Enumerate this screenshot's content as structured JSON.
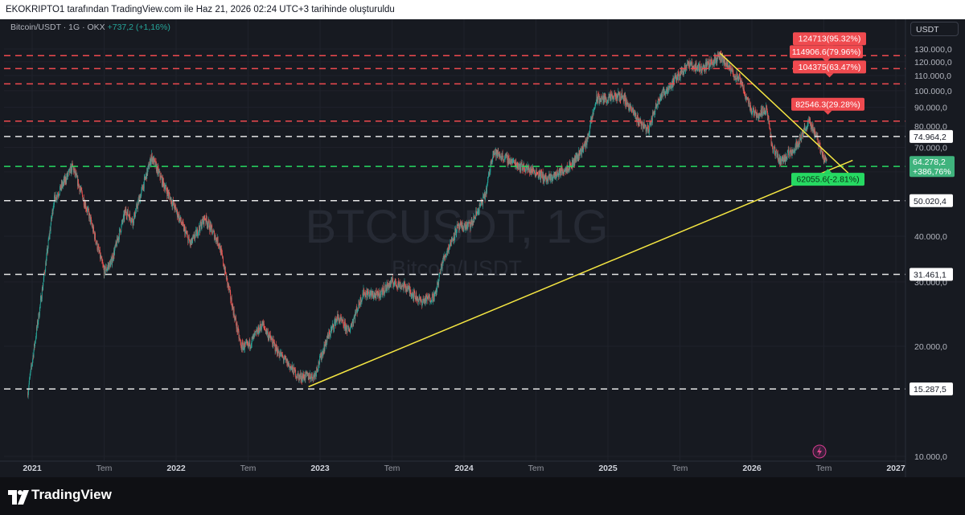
{
  "header": {
    "caption": "EKOKRIPTO1 tarafından TradingView.com ile Haz 21, 2026 02:24 UTC+3 tarihinde oluşturuldu"
  },
  "symbol": {
    "name": "Bitcoin/USDT · 1G · OKX",
    "change": "+737,2 (+1,16%)",
    "currency": "USDT"
  },
  "watermark": {
    "ticker": "BTCUSDT, 1G",
    "description": "Bitcoin/USDT"
  },
  "brand": {
    "name": "TradingView"
  },
  "colors": {
    "background": "#171a21",
    "up": "#26a69a",
    "down": "#ef5350",
    "trendline": "#f5e642",
    "white_level": "#e6e6e6",
    "target_red": "#ef4a4f",
    "target_green": "#26d962",
    "current_price": "#3fb37d"
  },
  "chart_data": {
    "type": "candlestick",
    "instrument": "Bitcoin/USDT",
    "timeframe": "1G",
    "exchange": "OKX",
    "x_range": [
      "2021",
      "2027"
    ],
    "x_ticks": [
      {
        "label": "2021",
        "t": 2021.0
      },
      {
        "label": "Tem",
        "t": 2021.5
      },
      {
        "label": "2022",
        "t": 2022.0
      },
      {
        "label": "Tem",
        "t": 2022.5
      },
      {
        "label": "2023",
        "t": 2023.0
      },
      {
        "label": "Tem",
        "t": 2023.5
      },
      {
        "label": "2024",
        "t": 2024.0
      },
      {
        "label": "Tem",
        "t": 2024.5
      },
      {
        "label": "2025",
        "t": 2025.0
      },
      {
        "label": "Tem",
        "t": 2025.5
      },
      {
        "label": "2026",
        "t": 2026.0
      },
      {
        "label": "Tem",
        "t": 2026.5
      },
      {
        "label": "2027",
        "t": 2027.0
      }
    ],
    "y_scale": "log",
    "y_range": [
      10000,
      130000
    ],
    "y_ticks": [
      {
        "label": "130.000,0",
        "v": 130000
      },
      {
        "label": "120.000,0",
        "v": 120000
      },
      {
        "label": "110.000,0",
        "v": 110000
      },
      {
        "label": "100.000,0",
        "v": 100000
      },
      {
        "label": "90.000,0",
        "v": 90000
      },
      {
        "label": "80.000,0",
        "v": 80000
      },
      {
        "label": "70.000,0",
        "v": 70000
      },
      {
        "label": "60.000,0",
        "v": 60000
      },
      {
        "label": "50.000,0",
        "v": 50000
      },
      {
        "label": "40.000,0",
        "v": 40000
      },
      {
        "label": "30.000,0",
        "v": 30000
      },
      {
        "label": "20.000,0",
        "v": 20000
      },
      {
        "label": "10.000,0",
        "v": 10000
      }
    ],
    "price_path": [
      [
        2020.97,
        15000
      ],
      [
        2021.05,
        25000
      ],
      [
        2021.1,
        35000
      ],
      [
        2021.15,
        50000
      ],
      [
        2021.28,
        62000
      ],
      [
        2021.4,
        45000
      ],
      [
        2021.5,
        32000
      ],
      [
        2021.55,
        34000
      ],
      [
        2021.65,
        47000
      ],
      [
        2021.7,
        44000
      ],
      [
        2021.83,
        66000
      ],
      [
        2021.9,
        57000
      ],
      [
        2022.0,
        47000
      ],
      [
        2022.1,
        38000
      ],
      [
        2022.2,
        45000
      ],
      [
        2022.3,
        38000
      ],
      [
        2022.45,
        20000
      ],
      [
        2022.5,
        20000
      ],
      [
        2022.6,
        23000
      ],
      [
        2022.7,
        19500
      ],
      [
        2022.85,
        16500
      ],
      [
        2022.96,
        16600
      ],
      [
        2023.05,
        21000
      ],
      [
        2023.12,
        24000
      ],
      [
        2023.2,
        22000
      ],
      [
        2023.3,
        28000
      ],
      [
        2023.4,
        27500
      ],
      [
        2023.5,
        30000
      ],
      [
        2023.6,
        29000
      ],
      [
        2023.7,
        26500
      ],
      [
        2023.8,
        27500
      ],
      [
        2023.85,
        34000
      ],
      [
        2023.95,
        42000
      ],
      [
        2024.05,
        43000
      ],
      [
        2024.15,
        52000
      ],
      [
        2024.2,
        68000
      ],
      [
        2024.3,
        65000
      ],
      [
        2024.4,
        62000
      ],
      [
        2024.5,
        60000
      ],
      [
        2024.58,
        57000
      ],
      [
        2024.67,
        60000
      ],
      [
        2024.75,
        63000
      ],
      [
        2024.85,
        72000
      ],
      [
        2024.92,
        95000
      ],
      [
        2025.0,
        95000
      ],
      [
        2025.1,
        97000
      ],
      [
        2025.2,
        84000
      ],
      [
        2025.28,
        78000
      ],
      [
        2025.35,
        95000
      ],
      [
        2025.45,
        105000
      ],
      [
        2025.55,
        118000
      ],
      [
        2025.65,
        115000
      ],
      [
        2025.78,
        124000
      ],
      [
        2025.85,
        114000
      ],
      [
        2025.92,
        106000
      ],
      [
        2026.0,
        88000
      ],
      [
        2026.05,
        86000
      ],
      [
        2026.1,
        90000
      ],
      [
        2026.12,
        80000
      ],
      [
        2026.14,
        70000
      ],
      [
        2026.2,
        64000
      ],
      [
        2026.3,
        70000
      ],
      [
        2026.35,
        76000
      ],
      [
        2026.38,
        80000
      ],
      [
        2026.4,
        82000
      ],
      [
        2026.45,
        75000
      ],
      [
        2026.5,
        65000
      ],
      [
        2026.52,
        64278
      ]
    ],
    "levels": [
      {
        "price": 124713,
        "style": "red-dashed",
        "label": "124713(95.32%)"
      },
      {
        "price": 114906.6,
        "style": "red-dashed",
        "label": "114906.6(79.96%)"
      },
      {
        "price": 104375,
        "style": "red-dashed",
        "label": "104375(63.47%)"
      },
      {
        "price": 82546.3,
        "style": "red-dashed",
        "label": "82546.3(29.28%)"
      },
      {
        "price": 74964.2,
        "style": "white-dashed",
        "label": "74.964,2"
      },
      {
        "price": 62055.6,
        "style": "green-dashed",
        "label": "62055.6(-2.81%)"
      },
      {
        "price": 50020.4,
        "style": "white-dashed",
        "label": "50.020,4"
      },
      {
        "price": 31461.1,
        "style": "white-dashed",
        "label": "31.461,1"
      },
      {
        "price": 15287.5,
        "style": "white-dashed",
        "label": "15.287,5"
      }
    ],
    "current_price": {
      "label": "64.278,2",
      "change": "+386,76%",
      "value": 64278.2
    },
    "trendlines": [
      {
        "from": [
          2022.92,
          15500
        ],
        "to": [
          2026.7,
          64500
        ]
      },
      {
        "from": [
          2025.78,
          126500
        ],
        "to": [
          2026.67,
          59500
        ]
      }
    ]
  }
}
